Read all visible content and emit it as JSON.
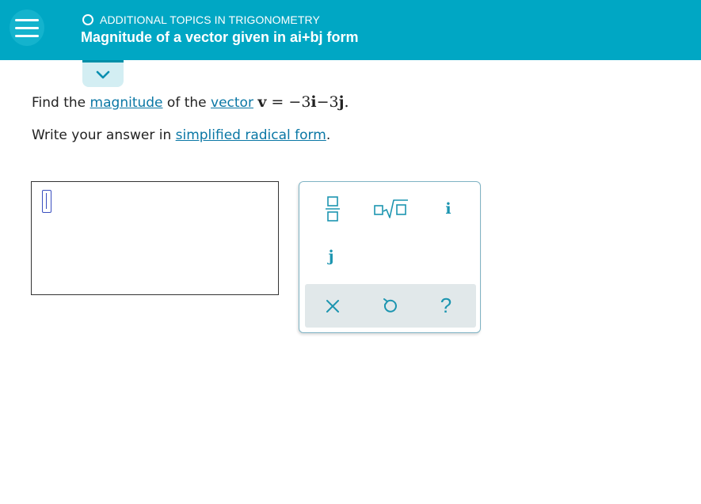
{
  "header": {
    "topic": "ADDITIONAL TOPICS IN TRIGONOMETRY",
    "title": "Magnitude of a vector given in ai+bj form"
  },
  "question": {
    "line1_prefix": "Find the ",
    "magnitude_link": "magnitude",
    "line1_mid": " of the ",
    "vector_link": "vector",
    "equation": {
      "var": "v",
      "eq": " = ",
      "minus1": "−",
      "coef1": "3",
      "unit1": "i",
      "minus2": "−",
      "coef2": "3",
      "unit2": "j",
      "end": "."
    },
    "line2_prefix": "Write your answer in ",
    "radical_link": "simplified radical form",
    "line2_end": "."
  },
  "answer": {
    "value": ""
  },
  "palette": {
    "i_label": "i",
    "j_label": "j",
    "help_label": "?"
  },
  "colors": {
    "header_bg": "#00a7c4",
    "link": "#0a77a5",
    "palette_icon": "#1c95b0"
  }
}
